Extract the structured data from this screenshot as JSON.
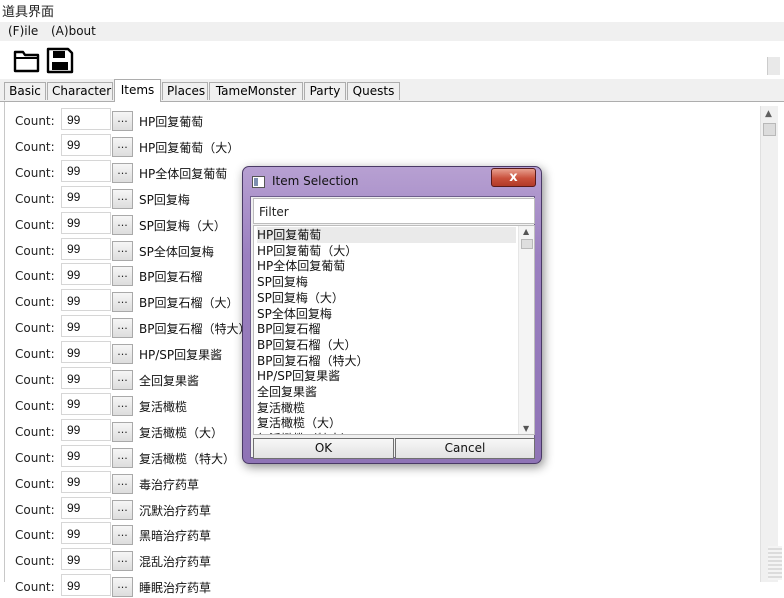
{
  "window": {
    "title": "道具界面"
  },
  "menu": [
    "(F)ile",
    "(A)bout"
  ],
  "toolbar": {
    "open_icon": "folder-open-icon",
    "save_icon": "floppy-disk-icon"
  },
  "tabs": [
    "Basic",
    "Character",
    "Items",
    "Places",
    "TameMonster",
    "Party",
    "Quests"
  ],
  "active_tab": "Items",
  "items": {
    "count_label": "Count:",
    "button_label": "...",
    "rows": [
      {
        "count": "99",
        "name": "HP回复葡萄"
      },
      {
        "count": "99",
        "name": "HP回复葡萄（大）"
      },
      {
        "count": "99",
        "name": "HP全体回复葡萄"
      },
      {
        "count": "99",
        "name": "SP回复梅"
      },
      {
        "count": "99",
        "name": "SP回复梅（大）"
      },
      {
        "count": "99",
        "name": "SP全体回复梅"
      },
      {
        "count": "99",
        "name": "BP回复石榴"
      },
      {
        "count": "99",
        "name": "BP回复石榴（大）"
      },
      {
        "count": "99",
        "name": "BP回复石榴（特大）"
      },
      {
        "count": "99",
        "name": "HP/SP回复果酱"
      },
      {
        "count": "99",
        "name": "全回复果酱"
      },
      {
        "count": "99",
        "name": "复活橄榄"
      },
      {
        "count": "99",
        "name": "复活橄榄（大）"
      },
      {
        "count": "99",
        "name": "复活橄榄（特大）"
      },
      {
        "count": "99",
        "name": "毒治疗药草"
      },
      {
        "count": "99",
        "name": "沉默治疗药草"
      },
      {
        "count": "99",
        "name": "黑暗治疗药草"
      },
      {
        "count": "99",
        "name": "混乱治疗药草"
      },
      {
        "count": "99",
        "name": "睡眠治疗药草"
      }
    ]
  },
  "dialog": {
    "title": "Item Selection",
    "close_label": "x",
    "filter_label": "Filter",
    "filter_value": "",
    "list": [
      "HP回复葡萄",
      "HP回复葡萄（大）",
      "HP全体回复葡萄",
      "SP回复梅",
      "SP回复梅（大）",
      "SP全体回复梅",
      "BP回复石榴",
      "BP回复石榴（大）",
      "BP回复石榴（特大）",
      "HP/SP回复果酱",
      "全回复果酱",
      "复活橄榄",
      "复活橄榄（大）",
      "复活橄榄（特大）"
    ],
    "selected_index": 0,
    "ok_label": "OK",
    "cancel_label": "Cancel"
  }
}
